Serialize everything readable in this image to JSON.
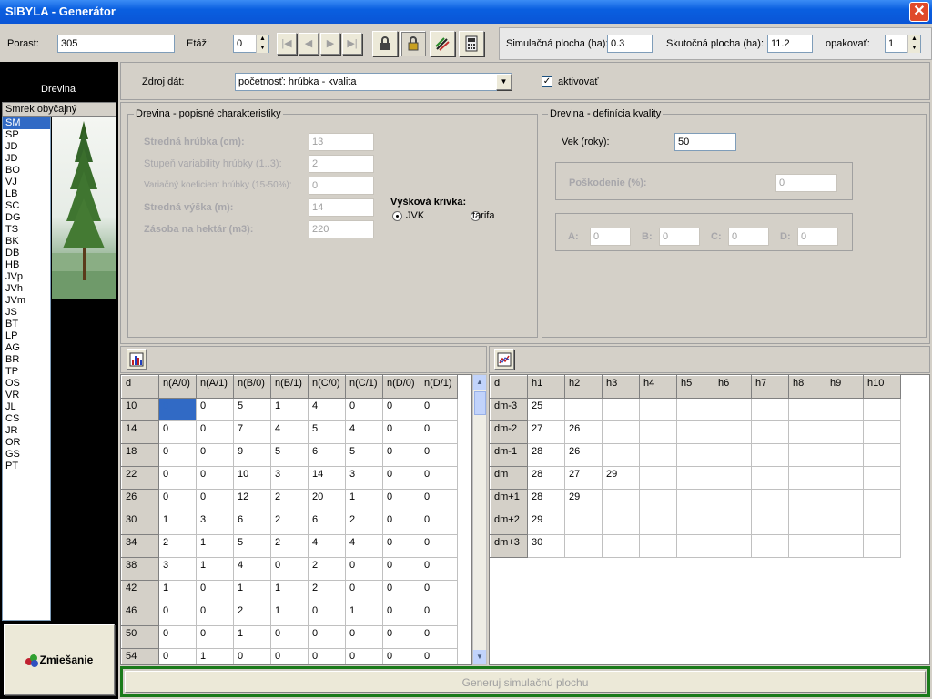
{
  "window": {
    "title": "SIBYLA - Generátor",
    "close_glyph": "✕"
  },
  "toolbar": {
    "porast_label": "Porast:",
    "porast_value": "305",
    "etaz_label": "Etáž:",
    "etaz_value": "0",
    "nav_first": "|◀",
    "nav_prev": "◀",
    "nav_next": "▶",
    "nav_last": "▶|",
    "sim_label": "Simulačná plocha (ha):",
    "sim_value": "0.3",
    "real_label": "Skutočná plocha (ha):",
    "real_value": "11.2",
    "repeat_label": "opakovať:",
    "repeat_value": "1"
  },
  "left": {
    "header": "Drevina",
    "selected_name": "Smrek obyčajný",
    "species": [
      "SM",
      "SP",
      "JD",
      "JD",
      "BO",
      "VJ",
      "LB",
      "SC",
      "DG",
      "TS",
      "BK",
      "DB",
      "HB",
      "JVp",
      "JVh",
      "JVm",
      "JS",
      "BT",
      "LP",
      "AG",
      "BR",
      "TP",
      "OS",
      "VR",
      "JL",
      "CS",
      "JR",
      "OR",
      "GS",
      "PT"
    ],
    "selected_index": 0,
    "mix_button": "Zmiešanie"
  },
  "source": {
    "label": "Zdroj dát:",
    "value": "početnosť: hrúbka - kvalita",
    "activate_label": "aktivovať",
    "activate_checked": true
  },
  "desc": {
    "title": "Drevina - popisné charakteristiky",
    "mean_diam_label": "Stredná hrúbka (cm):",
    "mean_diam_value": "13",
    "var_degree_label": "Stupeň variability hrúbky (1..3):",
    "var_degree_value": "2",
    "var_coef_label": "Variačný koeficient hrúbky (15-50%):",
    "var_coef_value": "0",
    "mean_height_label": "Stredná výška (m):",
    "mean_height_value": "14",
    "stock_label": "Zásoba na hektár (m3):",
    "stock_value": "220",
    "height_curve_label": "Výšková krivka:",
    "jvk_label": "JVK",
    "tarifa_label": "tarifa"
  },
  "quality": {
    "title": "Drevina - definícia kvality",
    "age_label": "Vek (roky):",
    "age_value": "50",
    "damage_label": "Poškodenie (%):",
    "damage_value": "0",
    "a_label": "A:",
    "a_value": "0",
    "b_label": "B:",
    "b_value": "0",
    "c_label": "C:",
    "c_value": "0",
    "d_label": "D:",
    "d_value": "0"
  },
  "left_table": {
    "headers": [
      "d",
      "n(A/0)",
      "n(A/1)",
      "n(B/0)",
      "n(B/1)",
      "n(C/0)",
      "n(C/1)",
      "n(D/0)",
      "n(D/1)"
    ],
    "rows": [
      [
        "10",
        "0",
        "0",
        "5",
        "1",
        "4",
        "0",
        "0",
        "0"
      ],
      [
        "14",
        "0",
        "0",
        "7",
        "4",
        "5",
        "4",
        "0",
        "0"
      ],
      [
        "18",
        "0",
        "0",
        "9",
        "5",
        "6",
        "5",
        "0",
        "0"
      ],
      [
        "22",
        "0",
        "0",
        "10",
        "3",
        "14",
        "3",
        "0",
        "0"
      ],
      [
        "26",
        "0",
        "0",
        "12",
        "2",
        "20",
        "1",
        "0",
        "0"
      ],
      [
        "30",
        "1",
        "3",
        "6",
        "2",
        "6",
        "2",
        "0",
        "0"
      ],
      [
        "34",
        "2",
        "1",
        "5",
        "2",
        "4",
        "4",
        "0",
        "0"
      ],
      [
        "38",
        "3",
        "1",
        "4",
        "0",
        "2",
        "0",
        "0",
        "0"
      ],
      [
        "42",
        "1",
        "0",
        "1",
        "1",
        "2",
        "0",
        "0",
        "0"
      ],
      [
        "46",
        "0",
        "0",
        "2",
        "1",
        "0",
        "1",
        "0",
        "0"
      ],
      [
        "50",
        "0",
        "0",
        "1",
        "0",
        "0",
        "0",
        "0",
        "0"
      ],
      [
        "54",
        "0",
        "1",
        "0",
        "0",
        "0",
        "0",
        "0",
        "0"
      ]
    ]
  },
  "right_table": {
    "headers": [
      "d",
      "h1",
      "h2",
      "h3",
      "h4",
      "h5",
      "h6",
      "h7",
      "h8",
      "h9",
      "h10"
    ],
    "rows": [
      [
        "dm-3",
        "25",
        "",
        "",
        "",
        "",
        "",
        "",
        "",
        "",
        ""
      ],
      [
        "dm-2",
        "27",
        "26",
        "",
        "",
        "",
        "",
        "",
        "",
        "",
        ""
      ],
      [
        "dm-1",
        "28",
        "26",
        "",
        "",
        "",
        "",
        "",
        "",
        "",
        ""
      ],
      [
        "dm",
        "28",
        "27",
        "29",
        "",
        "",
        "",
        "",
        "",
        "",
        ""
      ],
      [
        "dm+1",
        "28",
        "29",
        "",
        "",
        "",
        "",
        "",
        "",
        "",
        ""
      ],
      [
        "dm+2",
        "29",
        "",
        "",
        "",
        "",
        "",
        "",
        "",
        "",
        ""
      ],
      [
        "dm+3",
        "30",
        "",
        "",
        "",
        "",
        "",
        "",
        "",
        "",
        ""
      ]
    ]
  },
  "generate_button": "Generuj simulačnú plochu",
  "colors": {
    "selection": "#316ac5",
    "generate_border": "#1a7a1a"
  }
}
